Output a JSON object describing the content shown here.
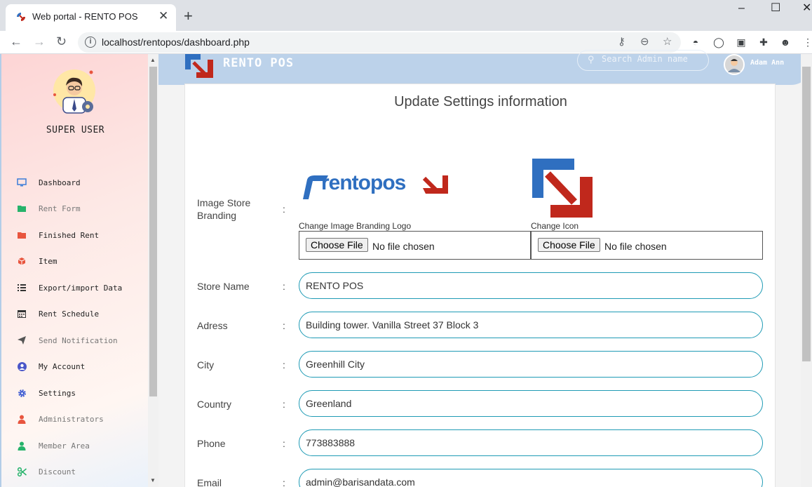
{
  "browser": {
    "tab_title": "Web portal - RENTO POS",
    "url": "localhost/rentopos/dashboard.php"
  },
  "sidebar": {
    "role": "SUPER USER",
    "items": [
      {
        "label": "Dashboard",
        "icon": "monitor-icon",
        "color": "#3b7dd8"
      },
      {
        "label": "Rent Form",
        "icon": "folder-icon",
        "color": "#27b36b"
      },
      {
        "label": "Finished Rent",
        "icon": "folder-icon",
        "color": "#e8553e"
      },
      {
        "label": "Item",
        "icon": "box-icon",
        "color": "#e8553e"
      },
      {
        "label": "Export/import Data",
        "icon": "list-icon",
        "color": "#333333"
      },
      {
        "label": "Rent Schedule",
        "icon": "calendar-icon",
        "color": "#333333"
      },
      {
        "label": "Send Notification",
        "icon": "send-icon",
        "color": "#555555"
      },
      {
        "label": "My Account",
        "icon": "user-circle-icon",
        "color": "#4a56c8"
      },
      {
        "label": "Settings",
        "icon": "gear-icon",
        "color": "#3d5ad1"
      },
      {
        "label": "Administrators",
        "icon": "person-icon",
        "color": "#e8553e"
      },
      {
        "label": "Member Area",
        "icon": "person-icon",
        "color": "#27b36b"
      },
      {
        "label": "Discount",
        "icon": "scissors-icon",
        "color": "#27b36b"
      }
    ]
  },
  "topbar": {
    "brand": "RENTO POS",
    "search_placeholder": "Search Admin name",
    "user_name": "Adam Ann"
  },
  "form": {
    "title": "Update Settings information",
    "branding": {
      "label": "Image Store Branding",
      "logo_caption": "Change Image Branding Logo",
      "icon_caption": "Change Icon",
      "choose_label": "Choose File",
      "no_file": "No file chosen",
      "logo_text": "rentopos"
    },
    "fields": [
      {
        "label": "Store Name",
        "value": "RENTO POS"
      },
      {
        "label": "Adress",
        "value": "Building tower. Vanilla Street 37 Block 3"
      },
      {
        "label": "City",
        "value": "Greenhill City"
      },
      {
        "label": "Country",
        "value": "Greenland"
      },
      {
        "label": "Phone",
        "value": "773883888"
      },
      {
        "label": "Email",
        "value": "admin@barisandata.com"
      }
    ]
  }
}
